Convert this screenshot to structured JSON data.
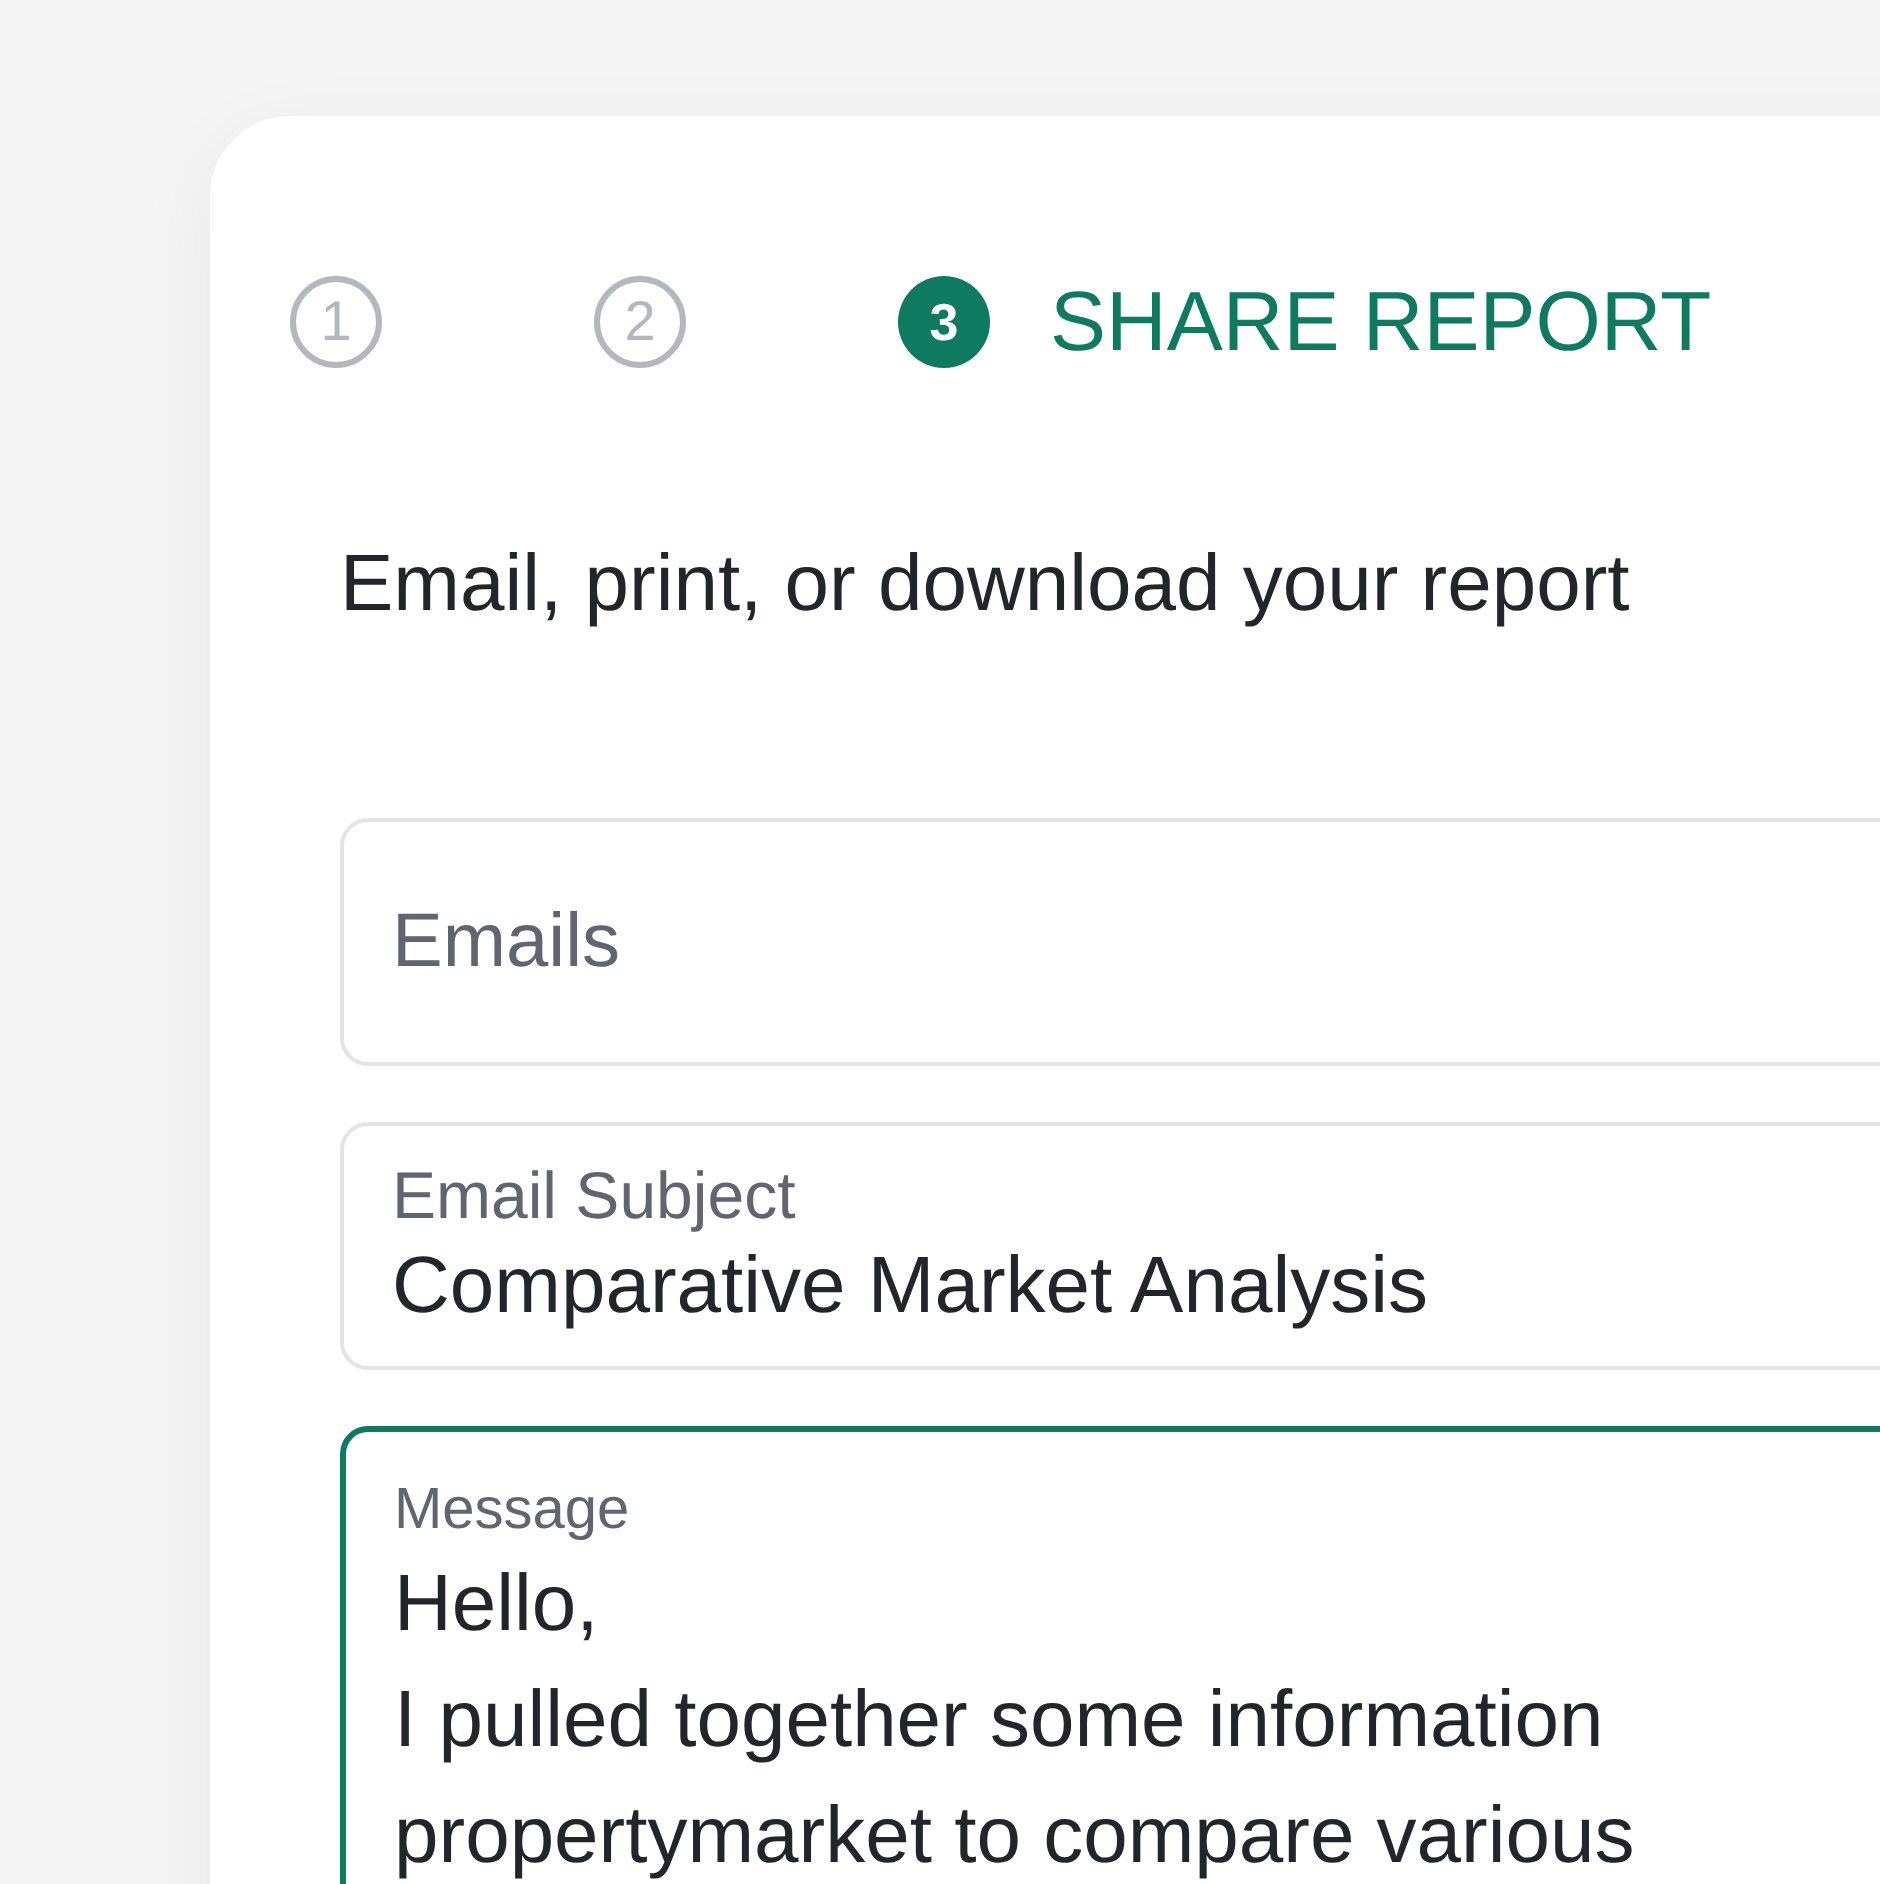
{
  "stepper": {
    "steps": [
      {
        "number": "1",
        "selected": false
      },
      {
        "number": "2",
        "selected": false
      },
      {
        "number": "3",
        "selected": true,
        "label": "SHARE REPORT"
      }
    ]
  },
  "subtitle": "Email, print, or download your report",
  "fields": [
    {
      "kind": "input",
      "placeholder": "Emails",
      "focused": false
    },
    {
      "kind": "input",
      "label": "Email Subject",
      "value": "Comparative Market Analysis",
      "focused": false
    },
    {
      "kind": "textarea",
      "label": "Message",
      "lines": [
        "Hello,",
        "I pulled together some information",
        "propertymarket to compare various"
      ],
      "focused": true
    }
  ]
}
